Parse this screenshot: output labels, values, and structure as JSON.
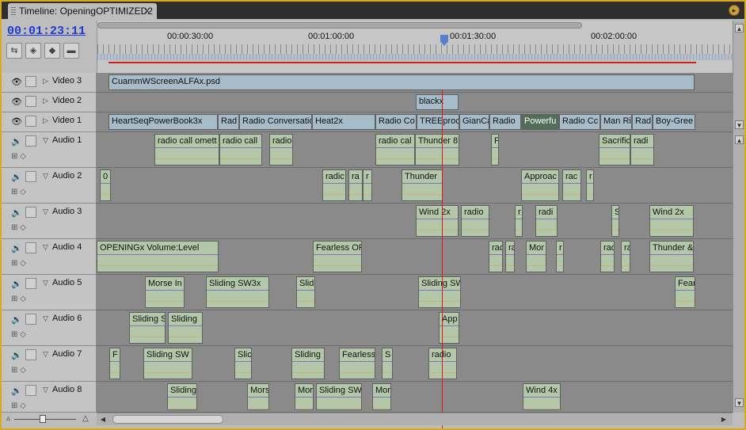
{
  "window": {
    "tab_title": "Timeline: OpeningOPTIMIZED2",
    "close_icon": "×"
  },
  "timecode": "00:01:23:11",
  "ruler": {
    "labels": [
      "00:00:30:00",
      "00:01:00:00",
      "00:01:30:00",
      "00:02:00:00"
    ]
  },
  "video_tracks": [
    {
      "name": "Video 3",
      "clips": [
        {
          "label": "CuammWScreenALFAx.psd"
        }
      ]
    },
    {
      "name": "Video 2",
      "clips": [
        {
          "label": "blackx"
        }
      ]
    },
    {
      "name": "Video 1",
      "clips": [
        {
          "label": "HeartSeqPowerBook3x"
        },
        {
          "label": "Rad"
        },
        {
          "label": "Radio Conversatio"
        },
        {
          "label": "Heat2x"
        },
        {
          "label": "Radio Co"
        },
        {
          "label": "TREEproc"
        },
        {
          "label": "GianCa"
        },
        {
          "label": "Radio"
        },
        {
          "label": "Powerfu"
        },
        {
          "label": "Radio Cc"
        },
        {
          "label": "Man Rin"
        },
        {
          "label": "Rad"
        },
        {
          "label": "Boy-Gree"
        }
      ]
    }
  ],
  "audio_tracks": [
    {
      "name": "Audio 1",
      "clips": [
        {
          "label": "radio call omett"
        },
        {
          "label": "radio call"
        },
        {
          "label": "radio"
        },
        {
          "label": "radio cal"
        },
        {
          "label": "Thunder 8"
        },
        {
          "label": "F"
        },
        {
          "label": "Sacrific"
        },
        {
          "label": "radi"
        }
      ]
    },
    {
      "name": "Audio 2",
      "clips": [
        {
          "label": "0"
        },
        {
          "label": "radic"
        },
        {
          "label": "ra"
        },
        {
          "label": "r"
        },
        {
          "label": "Thunder"
        },
        {
          "label": "Approac"
        },
        {
          "label": "rac"
        },
        {
          "label": "r"
        }
      ]
    },
    {
      "name": "Audio 3",
      "clips": [
        {
          "label": "Wind 2x"
        },
        {
          "label": "radio"
        },
        {
          "label": "r"
        },
        {
          "label": "radi"
        },
        {
          "label": "S"
        },
        {
          "label": "Wind 2x"
        }
      ]
    },
    {
      "name": "Audio 4",
      "clips": [
        {
          "label": "OPENINGx Volume:Level"
        },
        {
          "label": "Fearless OF"
        },
        {
          "label": "rac"
        },
        {
          "label": "ra"
        },
        {
          "label": "Mor"
        },
        {
          "label": "r"
        },
        {
          "label": "rad"
        },
        {
          "label": "ra"
        },
        {
          "label": "Thunder &"
        }
      ]
    },
    {
      "name": "Audio 5",
      "clips": [
        {
          "label": "Morse In"
        },
        {
          "label": "Sliding SW3x"
        },
        {
          "label": "Slid"
        },
        {
          "label": "Sliding SW"
        },
        {
          "label": "Fear"
        }
      ]
    },
    {
      "name": "Audio 6",
      "clips": [
        {
          "label": "Sliding S"
        },
        {
          "label": "Sliding"
        },
        {
          "label": "App"
        }
      ]
    },
    {
      "name": "Audio 7",
      "clips": [
        {
          "label": "F"
        },
        {
          "label": "Sliding SW"
        },
        {
          "label": "Slic"
        },
        {
          "label": "Sliding"
        },
        {
          "label": "Fearless"
        },
        {
          "label": "S"
        },
        {
          "label": "radio"
        }
      ]
    },
    {
      "name": "Audio 8",
      "clips": [
        {
          "label": "Sliding"
        },
        {
          "label": "Mors"
        },
        {
          "label": "Mor"
        },
        {
          "label": "Sliding SW"
        },
        {
          "label": "Mor"
        },
        {
          "label": "Wind 4x"
        }
      ]
    }
  ]
}
